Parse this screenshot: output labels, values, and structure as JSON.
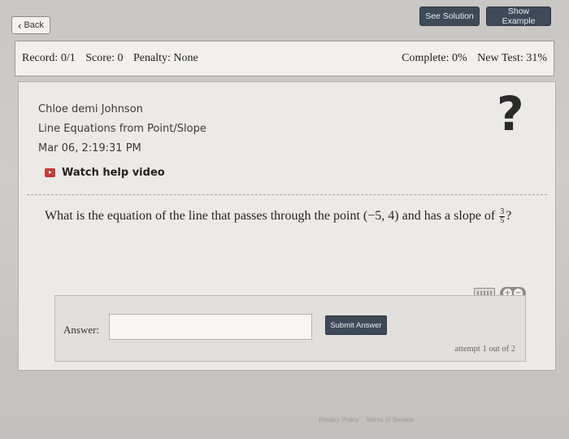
{
  "topbar": {
    "back_label": "Back",
    "see_solution_label": "See Solution",
    "show_example_label": "Show Example"
  },
  "status": {
    "record": "Record: 0/1",
    "score": "Score: 0",
    "penalty": "Penalty: None",
    "complete": "Complete: 0%",
    "new_test": "New Test: 31%"
  },
  "info": {
    "student_name": "Chloe demi Johnson",
    "assignment": "Line Equations from Point/Slope",
    "timestamp": "Mar 06, 2:19:31 PM",
    "help_video_label": "Watch help video"
  },
  "question": {
    "prefix": "What is the equation of the line that passes through the point ",
    "point": "(−5, 4)",
    "middle": " and has a slope of ",
    "slope_numerator": "3",
    "slope_denominator": "5",
    "suffix": "?"
  },
  "answer": {
    "label": "Answer:",
    "value": "",
    "submit_label": "Submit Answer",
    "attempt_text": "attempt 1 out of 2"
  },
  "footer": {
    "privacy_label": "Privacy Policy",
    "terms_label": "Terms of Service"
  },
  "colors": {
    "button_dark": "#3e4a58",
    "help_icon_red": "#c63b3b",
    "card_bg": "#eceae7"
  },
  "icons": [
    "chevron-left-icon",
    "play-video-icon",
    "question-mark-icon",
    "keyboard-icon",
    "plus-icon",
    "minus-icon"
  ]
}
